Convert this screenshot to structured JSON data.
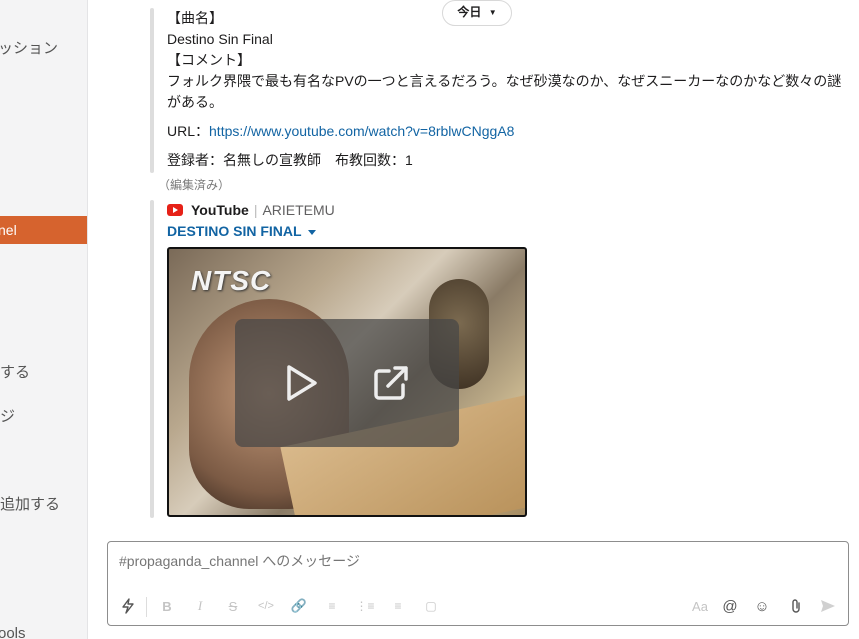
{
  "sidebar": {
    "items": [
      {
        "label": "ッション"
      },
      {
        "label": "nel"
      },
      {
        "label": "する"
      },
      {
        "label": "ジ"
      },
      {
        "label": "追加する"
      },
      {
        "label": "ools"
      }
    ]
  },
  "date_pill": {
    "label": "今日"
  },
  "message": {
    "song_header": "【曲名】",
    "song_title": "Destino Sin Final",
    "comment_header": "【コメント】",
    "comment_text": "フォルク界隈で最も有名なPVの一つと言えるだろう。なぜ砂漠なのか、なぜスニーカーなのかなど数々の謎がある。",
    "url_label": "URL：",
    "url": "https://www.youtube.com/watch?v=8rblwCNggA8",
    "registrant": "登録者：名無しの宣教師　布教回数：1",
    "edited": "（編集済み）"
  },
  "attachment": {
    "service": "YouTube",
    "separator": "|",
    "author": "ARIETEMU",
    "video_title": "DESTINO SIN FINAL",
    "thumbnail_text": "NTSC"
  },
  "composer": {
    "placeholder": "#propaganda_channel へのメッセージ",
    "format_label": "Aa"
  },
  "colors": {
    "accent": "#d6632e",
    "link": "#1264a3"
  }
}
